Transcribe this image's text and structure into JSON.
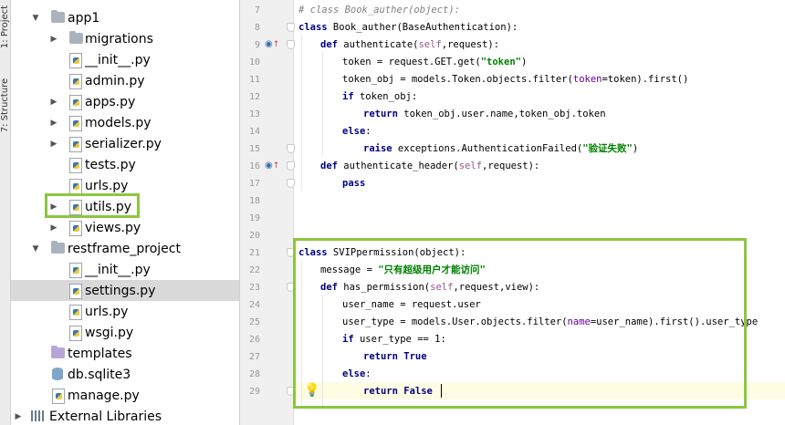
{
  "toolwindow_tabs": {
    "project": "1: Project",
    "structure": "7: Structure"
  },
  "tree": {
    "items": [
      {
        "label": "app1",
        "type": "folder",
        "expanded": true
      },
      {
        "label": "migrations",
        "type": "folder",
        "expanded": false
      },
      {
        "label": "__init__.py",
        "type": "python-file"
      },
      {
        "label": "admin.py",
        "type": "python-file"
      },
      {
        "label": "apps.py",
        "type": "python-file",
        "expandable": true
      },
      {
        "label": "models.py",
        "type": "python-file",
        "expandable": true
      },
      {
        "label": "serializer.py",
        "type": "python-file",
        "expandable": true
      },
      {
        "label": "tests.py",
        "type": "python-file"
      },
      {
        "label": "urls.py",
        "type": "python-file"
      },
      {
        "label": "utils.py",
        "type": "python-file",
        "expandable": true,
        "highlighted": true
      },
      {
        "label": "views.py",
        "type": "python-file",
        "expandable": true
      },
      {
        "label": "restframe_project",
        "type": "folder",
        "expanded": true
      },
      {
        "label": "__init__.py",
        "type": "python-file"
      },
      {
        "label": "settings.py",
        "type": "python-file",
        "selected": true
      },
      {
        "label": "urls.py",
        "type": "python-file"
      },
      {
        "label": "wsgi.py",
        "type": "python-file"
      },
      {
        "label": "templates",
        "type": "template-folder"
      },
      {
        "label": "db.sqlite3",
        "type": "database"
      },
      {
        "label": "manage.py",
        "type": "python-file"
      },
      {
        "label": "External Libraries",
        "type": "libraries",
        "expandable": true
      }
    ]
  },
  "editor": {
    "line_numbers": [
      "7",
      "8",
      "9",
      "10",
      "11",
      "12",
      "13",
      "14",
      "15",
      "16",
      "17",
      "18",
      "19",
      "20",
      "21",
      "22",
      "23",
      "24",
      "25",
      "26",
      "27",
      "28",
      "29"
    ],
    "code": {
      "l7": "# class Book_auther(object):",
      "l8_kw": "class",
      "l8_rest": " Book_auther(BaseAuthentication):",
      "l9_kw": "def",
      "l9_name": " authenticate(",
      "l9_self": "self",
      "l9_rest": ",request):",
      "l10_pre": "token = request.GET.get(",
      "l10_str": "\"token\"",
      "l10_post": ")",
      "l11_pre": "token_obj = models.Token.objects.filter(",
      "l11_param": "token",
      "l11_post": "=token).first()",
      "l12_kw": "if",
      "l12_rest": " token_obj:",
      "l13_kw": "return",
      "l13_rest": " token_obj.user.name,token_obj.token",
      "l14_kw": "else",
      "l14_rest": ":",
      "l15_kw": "raise",
      "l15_pre": " exceptions.AuthenticationFailed(",
      "l15_str": "\"验证失败\"",
      "l15_post": ")",
      "l16_kw": "def",
      "l16_name": " authenticate_header(",
      "l16_self": "self",
      "l16_rest": ",request):",
      "l17_kw": "pass",
      "l21_kw": "class",
      "l21_rest": " SVIPpermission(object):",
      "l22_pre": "message = ",
      "l22_str": "\"只有超级用户才能访问\"",
      "l23_kw": "def",
      "l23_name": " has_permission(",
      "l23_self": "self",
      "l23_rest": ",request,view):",
      "l24": "user_name = request.user",
      "l25_pre": "user_type = models.User.objects.filter(",
      "l25_param": "name",
      "l25_post": "=user_name).first().user_type",
      "l26_kw": "if",
      "l26_rest": " user_type == 1:",
      "l27_kw": "return",
      "l27_val": " True",
      "l28_kw": "else",
      "l28_rest": ":",
      "l29_kw": "return",
      "l29_val": " False"
    }
  }
}
